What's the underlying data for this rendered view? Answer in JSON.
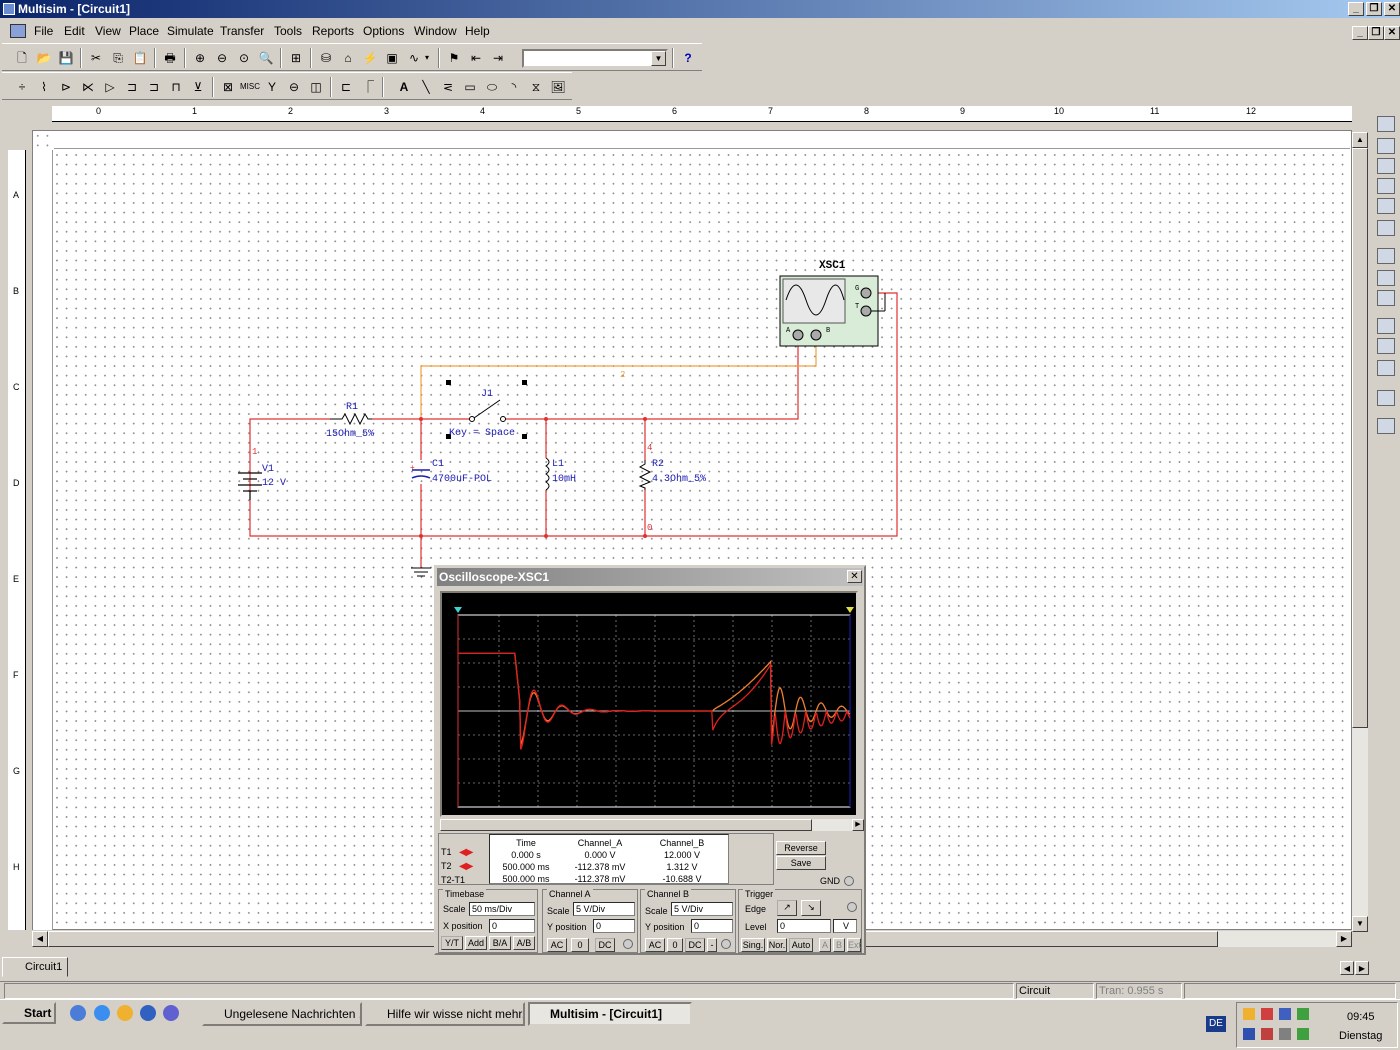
{
  "window": {
    "title": "Multisim - [Circuit1]"
  },
  "menu": [
    "File",
    "Edit",
    "View",
    "Place",
    "Simulate",
    "Transfer",
    "Tools",
    "Reports",
    "Options",
    "Window",
    "Help"
  ],
  "ruler": {
    "top": [
      "0",
      "1",
      "2",
      "3",
      "4",
      "5",
      "6",
      "7",
      "8",
      "9",
      "10",
      "11",
      "12"
    ],
    "left": [
      "A",
      "B",
      "C",
      "D",
      "E",
      "F",
      "G",
      "H"
    ]
  },
  "circuit": {
    "instrument": "XSC1",
    "inst_ports": {
      "a": "A",
      "b": "B",
      "g": "G",
      "t": "T"
    },
    "v1": {
      "name": "V1",
      "value": "12 V"
    },
    "r1": {
      "name": "R1",
      "value": "15Ohm_5%"
    },
    "j1": {
      "name": "J1",
      "value": "Key = Space"
    },
    "c1": {
      "name": "C1",
      "value": "4700uF-POL"
    },
    "l1": {
      "name": "L1",
      "value": "10mH"
    },
    "r2": {
      "name": "R2",
      "value": "4.3Ohm_5%"
    },
    "nodes": {
      "n1": "1",
      "n2": "2",
      "n4": "4",
      "n0": "0"
    }
  },
  "oscilloscope": {
    "title": "Oscilloscope-XSC1",
    "readout": {
      "headers": [
        "Time",
        "Channel_A",
        "Channel_B"
      ],
      "rows": [
        {
          "label": "T1",
          "time": "0.000 s",
          "a": "0.000 V",
          "b": "12.000 V"
        },
        {
          "label": "T2",
          "time": "500.000 ms",
          "a": "-112.378 mV",
          "b": "1.312 V"
        },
        {
          "label": "T2-T1",
          "time": "500.000 ms",
          "a": "-112.378 mV",
          "b": "-10.688 V"
        }
      ]
    },
    "buttons": {
      "reverse": "Reverse",
      "save": "Save",
      "gnd": "GND"
    },
    "timebase": {
      "title": "Timebase",
      "scale_label": "Scale",
      "scale": "50 ms/Div",
      "xpos_label": "X position",
      "xpos": "0",
      "modes": [
        "Y/T",
        "Add",
        "B/A",
        "A/B"
      ]
    },
    "channel_a": {
      "title": "Channel A",
      "scale_label": "Scale",
      "scale": "5  V/Div",
      "ypos_label": "Y position",
      "ypos": "0",
      "coupling": [
        "AC",
        "0",
        "DC"
      ]
    },
    "channel_b": {
      "title": "Channel B",
      "scale_label": "Scale",
      "scale": "5  V/Div",
      "ypos_label": "Y position",
      "ypos": "0",
      "coupling": [
        "AC",
        "0",
        "DC",
        "-"
      ]
    },
    "trigger": {
      "title": "Trigger",
      "edge_label": "Edge",
      "level_label": "Level",
      "level": "0",
      "level_unit": "V",
      "modes": [
        "Sing.",
        "Nor.",
        "Auto",
        "A",
        "B",
        "Ext"
      ]
    }
  },
  "tabs": [
    "Circuit1"
  ],
  "status": {
    "modified": "Circuit modified",
    "tran": "Tran: 0.955 s"
  },
  "taskbar": {
    "start": "Start",
    "buttons": [
      "Ungelesene Nachrichten ...",
      "Hilfe wir wisse nicht mehr...",
      "Multisim - [Circuit1]"
    ],
    "lang": "DE",
    "time": "09:45",
    "day": "Dienstag"
  },
  "colors": {
    "wire": "#e03030",
    "wire2": "#f0a040",
    "schematic_text": "#1a1ab4",
    "trace_a": "#e02020",
    "trace_b": "#f08030"
  }
}
